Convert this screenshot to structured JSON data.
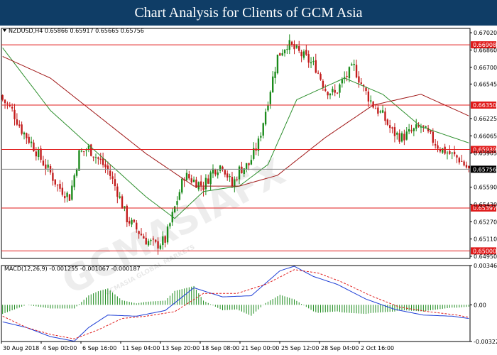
{
  "banner": {
    "title": "Chart Analysis for Clients of GCM Asia"
  },
  "chart_data": {
    "type": "candlestick",
    "symbol_header": "NZDUSD,H4 0.65866 0.65917 0.65665 0.65756",
    "price_axis": {
      "ylim": [
        0.6493,
        0.6706
      ],
      "ticks": [
        "0.67020",
        "0.66860",
        "0.66700",
        "0.66545",
        "0.66225",
        "0.66065",
        "0.65905",
        "0.65590",
        "0.65430",
        "0.65270",
        "0.65110",
        "0.64950"
      ]
    },
    "x_tick_labels": [
      "30 Aug 2018",
      "4 Sep 00:00",
      "6 Sep 16:00",
      "11 Sep 04:00",
      "13 Sep 20:00",
      "18 Sep 08:00",
      "21 Sep 00:00",
      "25 Sep 12:00",
      "28 Sep 04:00",
      "2 Oct 16:00"
    ],
    "levels": [
      {
        "value": "0.66908",
        "color": "#e01b1b"
      },
      {
        "value": "0.66350",
        "color": "#e01b1b"
      },
      {
        "value": "0.65939",
        "color": "#e01b1b"
      },
      {
        "value": "0.65397",
        "color": "#e01b1b"
      },
      {
        "value": "0.65000",
        "color": "#e01b1b"
      }
    ],
    "current_price": {
      "value": "0.65756",
      "color": "#000000"
    },
    "close_path": [
      [
        0,
        0.664
      ],
      [
        4,
        0.663
      ],
      [
        8,
        0.6612
      ],
      [
        12,
        0.66
      ],
      [
        16,
        0.6585
      ],
      [
        20,
        0.6572
      ],
      [
        23,
        0.656
      ],
      [
        28,
        0.655
      ],
      [
        32,
        0.659
      ],
      [
        36,
        0.6595
      ],
      [
        40,
        0.6585
      ],
      [
        44,
        0.6575
      ],
      [
        48,
        0.6555
      ],
      [
        52,
        0.653
      ],
      [
        56,
        0.652
      ],
      [
        60,
        0.651
      ],
      [
        64,
        0.6505
      ],
      [
        68,
        0.651
      ],
      [
        72,
        0.654
      ],
      [
        76,
        0.657
      ],
      [
        80,
        0.6565
      ],
      [
        84,
        0.656
      ],
      [
        88,
        0.6575
      ],
      [
        92,
        0.658
      ],
      [
        96,
        0.656
      ],
      [
        99,
        0.6575
      ],
      [
        103,
        0.658
      ],
      [
        107,
        0.66
      ],
      [
        111,
        0.664
      ],
      [
        115,
        0.668
      ],
      [
        119,
        0.6692
      ],
      [
        123,
        0.6685
      ],
      [
        127,
        0.6678
      ],
      [
        131,
        0.667
      ],
      [
        135,
        0.665
      ],
      [
        139,
        0.6645
      ],
      [
        143,
        0.666
      ],
      [
        147,
        0.667
      ],
      [
        151,
        0.665
      ],
      [
        155,
        0.6635
      ],
      [
        159,
        0.6625
      ],
      [
        163,
        0.661
      ],
      [
        167,
        0.6605
      ],
      [
        171,
        0.661
      ],
      [
        175,
        0.6615
      ],
      [
        179,
        0.6605
      ],
      [
        183,
        0.6595
      ],
      [
        187,
        0.659
      ],
      [
        191,
        0.6585
      ],
      [
        195,
        0.6575
      ]
    ],
    "ma_fast_path": [
      [
        0,
        0.6688
      ],
      [
        20,
        0.663
      ],
      [
        40,
        0.659
      ],
      [
        60,
        0.655
      ],
      [
        72,
        0.653
      ],
      [
        84,
        0.6555
      ],
      [
        99,
        0.656
      ],
      [
        111,
        0.658
      ],
      [
        123,
        0.664
      ],
      [
        143,
        0.666
      ],
      [
        159,
        0.6645
      ],
      [
        175,
        0.6615
      ],
      [
        195,
        0.66
      ]
    ],
    "ma_slow_path": [
      [
        0,
        0.668
      ],
      [
        20,
        0.666
      ],
      [
        40,
        0.6625
      ],
      [
        60,
        0.659
      ],
      [
        80,
        0.656
      ],
      [
        99,
        0.656
      ],
      [
        115,
        0.657
      ],
      [
        135,
        0.6605
      ],
      [
        155,
        0.6635
      ],
      [
        175,
        0.6645
      ],
      [
        195,
        0.6625
      ]
    ],
    "macd": {
      "header": "MACD(12,26,9) -0.001255 -0.001067 -0.000187",
      "ylim": [
        -0.00323,
        0.00346
      ],
      "ticks": [
        "0.003463",
        "0.00",
        "-0.003223"
      ],
      "macd_path": [
        [
          0,
          -0.0015
        ],
        [
          10,
          -0.002
        ],
        [
          20,
          -0.0028
        ],
        [
          30,
          -0.0032
        ],
        [
          36,
          -0.002
        ],
        [
          44,
          -0.0009
        ],
        [
          56,
          -0.001
        ],
        [
          68,
          -0.0005
        ],
        [
          80,
          0.0015
        ],
        [
          92,
          0.0007
        ],
        [
          104,
          0.0008
        ],
        [
          116,
          0.003
        ],
        [
          122,
          0.0034
        ],
        [
          130,
          0.0025
        ],
        [
          140,
          0.0018
        ],
        [
          152,
          0.0005
        ],
        [
          164,
          -0.0004
        ],
        [
          176,
          -0.0009
        ],
        [
          188,
          -0.001
        ],
        [
          195,
          -0.0012
        ]
      ],
      "signal_path": [
        [
          0,
          -0.001
        ],
        [
          10,
          -0.002
        ],
        [
          20,
          -0.0026
        ],
        [
          30,
          -0.003
        ],
        [
          40,
          -0.0022
        ],
        [
          50,
          -0.0012
        ],
        [
          60,
          -0.001
        ],
        [
          72,
          -0.0006
        ],
        [
          84,
          0.001
        ],
        [
          98,
          0.001
        ],
        [
          110,
          0.0018
        ],
        [
          122,
          0.0031
        ],
        [
          132,
          0.0028
        ],
        [
          142,
          0.002
        ],
        [
          154,
          0.0008
        ],
        [
          166,
          -0.0002
        ],
        [
          178,
          -0.0006
        ],
        [
          190,
          -0.0009
        ],
        [
          195,
          -0.0011
        ]
      ]
    }
  },
  "watermark": {
    "brand": "GCMASIAFX",
    "sub": "GCMASIA GLOBAL MARKETS"
  },
  "colors": {
    "bull": "#1a8a1a",
    "bear": "#c21a1a",
    "ma_fast": "#2d8f2d",
    "ma_slow": "#a11818",
    "macd": "#1f3fd6",
    "signal": "#e02020"
  }
}
